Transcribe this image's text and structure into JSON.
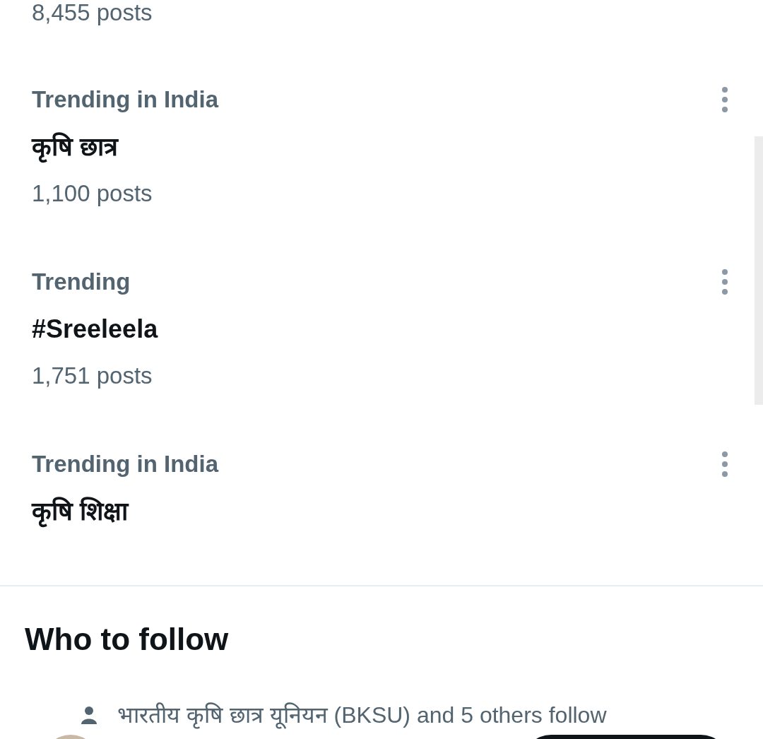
{
  "top_post_count": "8,455 posts",
  "trends": [
    {
      "category": "Trending in India",
      "title": "कृषि छात्र",
      "posts": "1,100 posts"
    },
    {
      "category": "Trending",
      "title": "#Sreeleela",
      "posts": "1,751 posts"
    },
    {
      "category": "Trending in India",
      "title": "कृषि शिक्षा"
    }
  ],
  "who_to_follow": {
    "heading": "Who to follow",
    "social_context": "भारतीय कृषि छात्र यूनियन (BKSU) and 5 others follow"
  }
}
